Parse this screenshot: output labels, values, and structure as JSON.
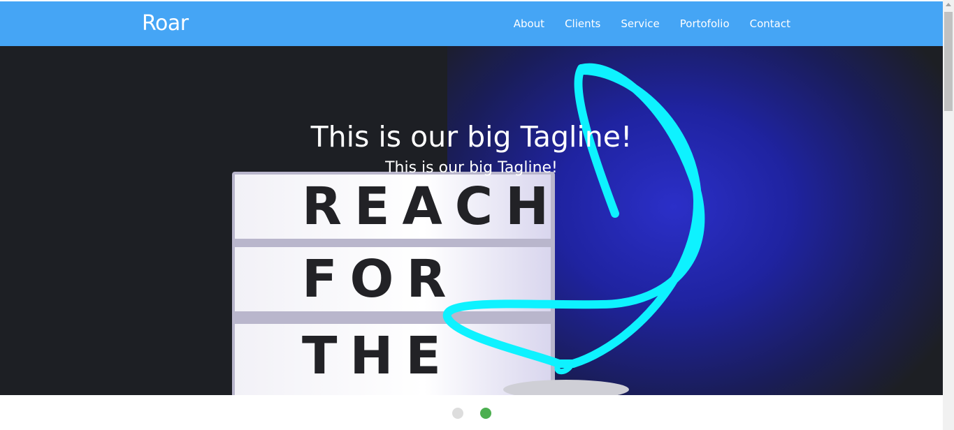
{
  "navbar": {
    "brand": "Roar",
    "links": [
      "About",
      "Clients",
      "Service",
      "Portofolio",
      "Contact"
    ],
    "background": "#45a5f5"
  },
  "hero": {
    "title": "This is our big Tagline!",
    "subtitle": "This is our big Tagline!",
    "lightbox_rows": [
      "REACH",
      "FOR",
      "THE"
    ],
    "accent_neon": "#14e6f0"
  },
  "carousel": {
    "slide_count": 2,
    "active_index": 1,
    "active_color": "#4caf50",
    "inactive_color": "#dddddd"
  }
}
